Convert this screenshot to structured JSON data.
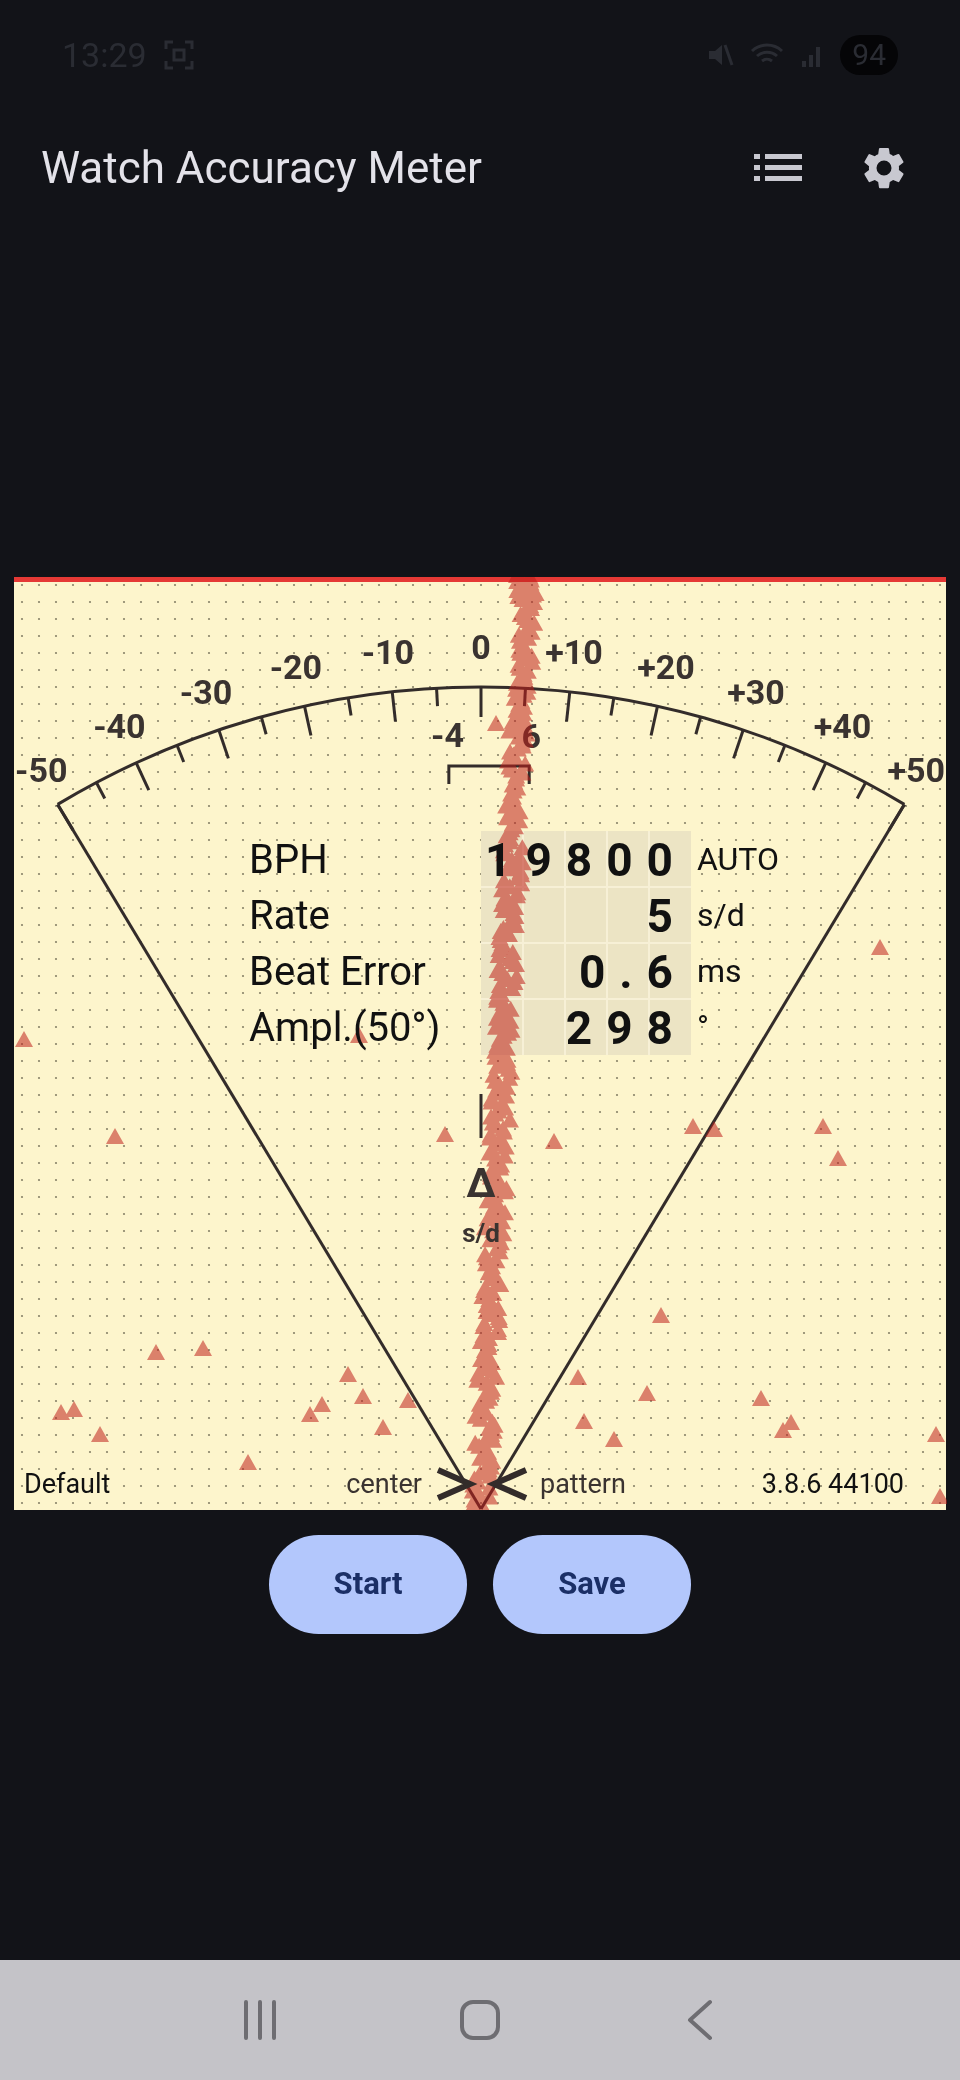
{
  "status_bar": {
    "time": "13:29",
    "battery": "94"
  },
  "app_bar": {
    "title": "Watch Accuracy Meter"
  },
  "dial": {
    "scale_labels": [
      "-50",
      "-40",
      "-30",
      "-20",
      "-10",
      "0",
      "+10",
      "+20",
      "+30",
      "+40",
      "+50"
    ],
    "window_labels": [
      "-4",
      "6"
    ],
    "readings": [
      {
        "label": "BPH",
        "value": "19800",
        "unit": "AUTO"
      },
      {
        "label": "Rate",
        "value": "5",
        "unit": "s/d"
      },
      {
        "label": "Beat Error",
        "value": "0.6",
        "unit": "ms"
      },
      {
        "label": "Ampl.(50°)",
        "value": "298",
        "unit": "°"
      }
    ],
    "delta_symbol": "Δ",
    "delta_unit": "s/d",
    "footer": {
      "profile": "Default",
      "left_hint": "center",
      "right_hint": "pattern",
      "version": "3.8.6 44100"
    }
  },
  "buttons": [
    {
      "label": "Start"
    },
    {
      "label": "Save"
    }
  ]
}
